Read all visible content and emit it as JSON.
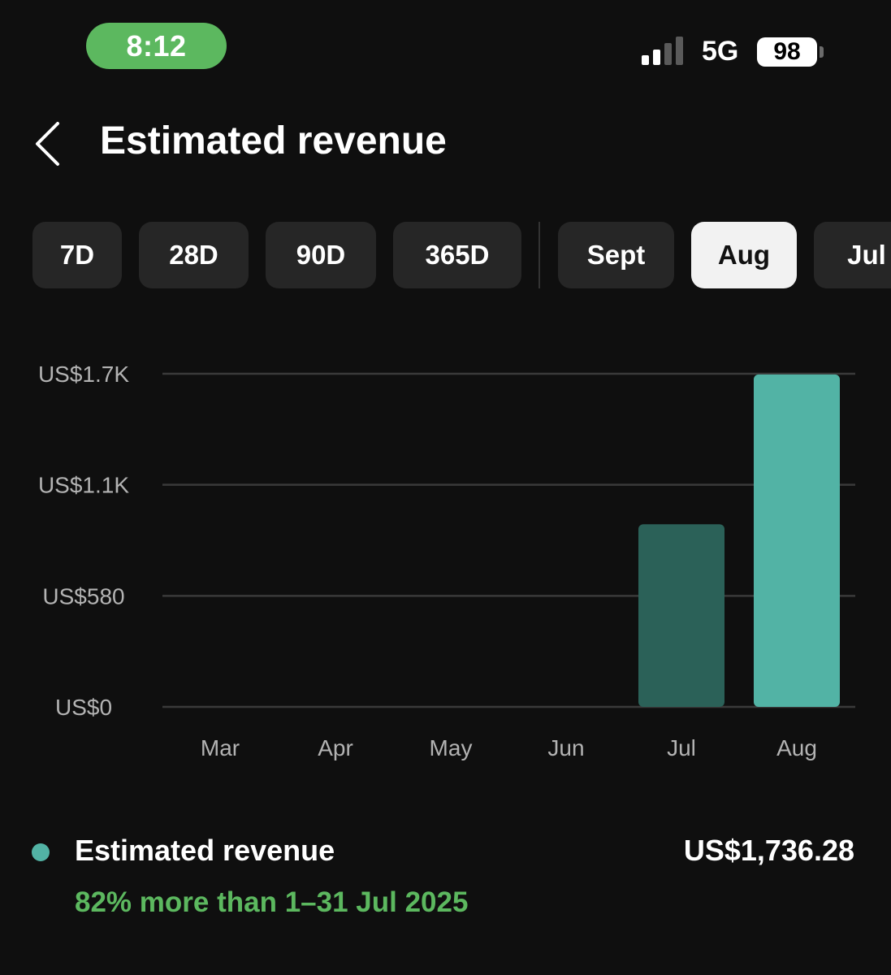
{
  "status_bar": {
    "time": "8:12",
    "network": "5G",
    "battery": "98"
  },
  "header": {
    "title": "Estimated revenue",
    "back_icon": "chevron-left-icon"
  },
  "periods": [
    {
      "label": "7D",
      "selected": false
    },
    {
      "label": "28D",
      "selected": false
    },
    {
      "label": "90D",
      "selected": false
    },
    {
      "label": "365D",
      "selected": false
    },
    {
      "label": "Sept",
      "selected": false
    },
    {
      "label": "Aug",
      "selected": true
    },
    {
      "label": "Jul",
      "selected": false
    }
  ],
  "colors": {
    "background": "#0f0f0f",
    "accent": "#52b3a5",
    "accent_muted": "#2b6158",
    "positive": "#5cb85f",
    "time_pill": "#5cb85f",
    "chip": "#262626",
    "chip_selected": "#f2f2f2"
  },
  "chart_data": {
    "type": "bar",
    "categories": [
      "Mar",
      "Apr",
      "May",
      "Jun",
      "Jul",
      "Aug"
    ],
    "values": [
      0,
      0,
      0,
      0,
      954,
      1736.28
    ],
    "highlighted_category": "Aug",
    "yticks": [
      {
        "value": 0,
        "label": "US$0"
      },
      {
        "value": 580,
        "label": "US$580"
      },
      {
        "value": 1160,
        "label": "US$1.1K"
      },
      {
        "value": 1740,
        "label": "US$1.7K"
      }
    ],
    "ylim": [
      0,
      1740
    ],
    "grid": true
  },
  "summary": {
    "label": "Estimated revenue",
    "value": "US$1,736.28",
    "comparison": "82% more than 1–31 Jul 2025"
  }
}
